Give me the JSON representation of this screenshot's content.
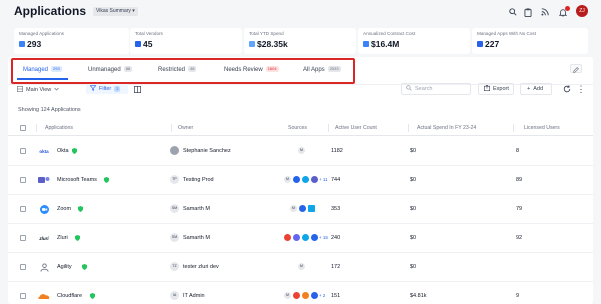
{
  "header": {
    "title": "Applications",
    "view_badge": "Vikas Summary ▾",
    "user_initials": "ZJ",
    "icons": [
      "search-icon",
      "clipboard-icon",
      "rss-icon",
      "bell-icon"
    ]
  },
  "stats": [
    {
      "label": "Managed Applications",
      "value": "293"
    },
    {
      "label": "Total Vendors",
      "value": "45"
    },
    {
      "label": "Total YTD Spend",
      "value": "$28.35k"
    },
    {
      "label": "Annualized Contract Cost",
      "value": "$16.4M"
    },
    {
      "label": "Managed Apps With No Cost",
      "value": "227"
    }
  ],
  "tabs": [
    {
      "label": "Managed",
      "count": "293"
    },
    {
      "label": "Unmanaged",
      "count": "88"
    },
    {
      "label": "Restricted",
      "count": "48"
    },
    {
      "label": "Needs Review",
      "count": "1604"
    },
    {
      "label": "All Apps",
      "count": "2033"
    }
  ],
  "toolbar": {
    "view_label": "Main View",
    "filter_label": "Filter",
    "filter_count": "2",
    "search_placeholder": "Search",
    "export_label": "Export",
    "add_label": "Add"
  },
  "showing_text": "Showing 124 Applications",
  "columns": [
    "Applications",
    "Owner",
    "Sources",
    "Active User Count",
    "Actual Spend In FY 23-24",
    "Licensed Users"
  ],
  "rows": [
    {
      "app": "Okta",
      "logo_text": "okta",
      "logo_color": "#1d4ed8",
      "owner_initials": "",
      "owner": "Stephanie Sanchez",
      "sources_more": "",
      "users": "1182",
      "spend": "$0",
      "licensed": "8"
    },
    {
      "app": "Microsoft Teams",
      "logo_text": "",
      "logo_color": "#5b5fc7",
      "owner_initials": "TP",
      "owner": "Testing Prod",
      "sources_more": "+ 11",
      "users": "744",
      "spend": "$0",
      "licensed": "89"
    },
    {
      "app": "Zoom",
      "logo_text": "",
      "logo_color": "#2d8cff",
      "owner_initials": "SM",
      "owner": "Samarth M",
      "sources_more": "",
      "users": "353",
      "spend": "$0",
      "licensed": "79"
    },
    {
      "app": "Zluri",
      "logo_text": "zluri",
      "logo_color": "#111827",
      "owner_initials": "SM",
      "owner": "Samarth M",
      "sources_more": "+ 15",
      "users": "240",
      "spend": "$0",
      "licensed": "92"
    },
    {
      "app": "Agility",
      "logo_text": "",
      "logo_color": "#6b7280",
      "owner_initials": "TZ",
      "owner": "tester zluri dev",
      "sources_more": "",
      "users": "172",
      "spend": "$0",
      "licensed": ""
    },
    {
      "app": "Cloudflare",
      "logo_text": "",
      "logo_color": "#f38020",
      "owner_initials": "IA",
      "owner": "IT Admin",
      "sources_more": "+ 2",
      "users": "151",
      "spend": "$4.81k",
      "licensed": "9"
    }
  ],
  "colors": {
    "accent": "#2563eb",
    "highlight": "#dc2626",
    "verified": "#22c55e"
  }
}
